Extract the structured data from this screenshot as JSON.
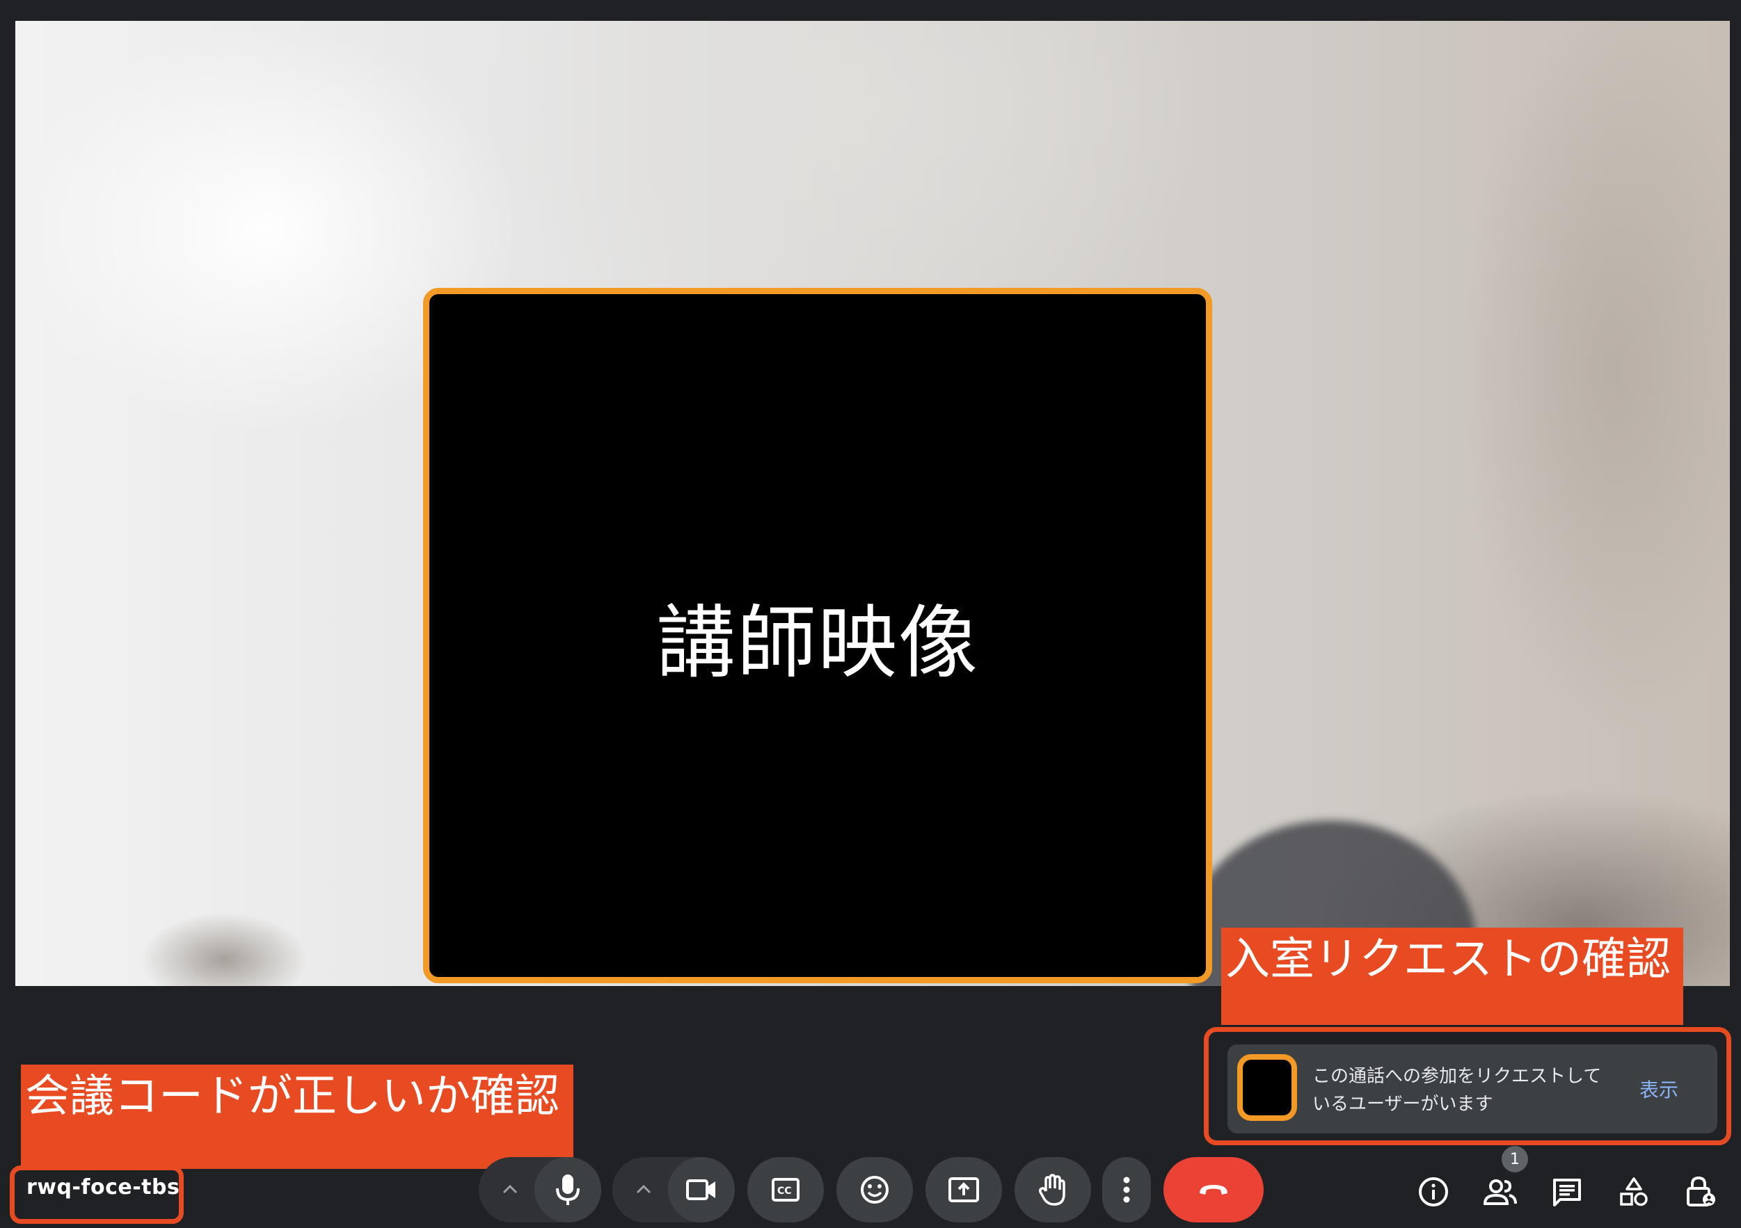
{
  "stage": {
    "tutor_video_label": "講師映像"
  },
  "annotations": {
    "request_check": "入室リクエストの確認",
    "code_check": "会議コードが正しいか確認"
  },
  "meeting": {
    "code": "rwq-foce-tbs"
  },
  "join_request": {
    "message": "この通話への参加をリクエストしているユーザーがいます",
    "action_label": "表示"
  },
  "controls": {
    "mic": {
      "icon": "mic-icon",
      "options_icon": "chevron-up-icon"
    },
    "camera": {
      "icon": "videocam-icon",
      "options_icon": "chevron-up-icon"
    },
    "captions": {
      "icon": "closed-caption-icon"
    },
    "reactions": {
      "icon": "emoji-icon"
    },
    "present": {
      "icon": "present-screen-icon"
    },
    "raise_hand": {
      "icon": "hand-icon"
    },
    "more": {
      "icon": "more-vert-icon"
    },
    "leave": {
      "icon": "call-end-icon",
      "color": "#ea4335"
    }
  },
  "side_controls": {
    "info": {
      "icon": "info-icon"
    },
    "people": {
      "icon": "people-icon",
      "badge": "1"
    },
    "chat": {
      "icon": "chat-icon"
    },
    "activities": {
      "icon": "shapes-icon"
    },
    "host_controls": {
      "icon": "lock-person-icon"
    }
  },
  "colors": {
    "background": "#202124",
    "accent_orange": "#f29a25",
    "annotation_red": "#e84a22",
    "link_blue": "#8ab4f8"
  }
}
